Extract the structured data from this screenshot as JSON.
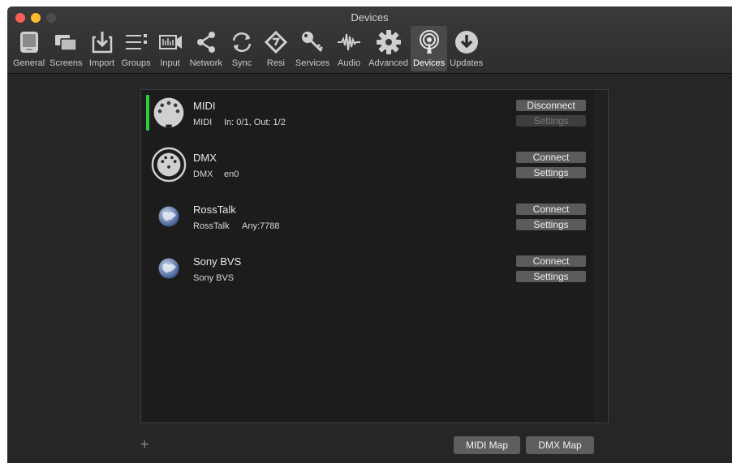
{
  "window": {
    "title": "Devices"
  },
  "toolbar": {
    "items": [
      {
        "label": "General",
        "icon": "general-icon"
      },
      {
        "label": "Screens",
        "icon": "screens-icon"
      },
      {
        "label": "Import",
        "icon": "import-icon"
      },
      {
        "label": "Groups",
        "icon": "groups-icon"
      },
      {
        "label": "Input",
        "icon": "input-icon"
      },
      {
        "label": "Network",
        "icon": "network-icon"
      },
      {
        "label": "Sync",
        "icon": "sync-icon"
      },
      {
        "label": "Resi",
        "icon": "resi-icon"
      },
      {
        "label": "Services",
        "icon": "services-key-icon"
      },
      {
        "label": "Audio",
        "icon": "audio-waveform-icon"
      },
      {
        "label": "Advanced",
        "icon": "advanced-gear-icon"
      },
      {
        "label": "Devices",
        "icon": "devices-broadcast-icon",
        "selected": true
      },
      {
        "label": "Updates",
        "icon": "updates-download-icon"
      }
    ]
  },
  "devices": [
    {
      "name": "MIDI",
      "type": "MIDI",
      "detail": "In: 0/1, Out: 1/2",
      "primary": "Disconnect",
      "secondary": "Settings",
      "secondary_disabled": true,
      "connected": true,
      "icon": "midi-connector-icon"
    },
    {
      "name": "DMX",
      "type": "DMX",
      "detail": "en0",
      "primary": "Connect",
      "secondary": "Settings",
      "secondary_disabled": false,
      "connected": false,
      "icon": "dmx-connector-icon"
    },
    {
      "name": "RossTalk",
      "type": "RossTalk",
      "detail": "Any:7788",
      "primary": "Connect",
      "secondary": "Settings",
      "secondary_disabled": false,
      "connected": false,
      "icon": "globe-icon"
    },
    {
      "name": "Sony BVS",
      "type": "Sony BVS",
      "detail": "",
      "primary": "Connect",
      "secondary": "Settings",
      "secondary_disabled": false,
      "connected": false,
      "icon": "globe-icon"
    }
  ],
  "footer": {
    "add_label": "+",
    "midi_map_label": "MIDI Map",
    "dmx_map_label": "DMX Map"
  },
  "colors": {
    "connected_accent": "#2ecc40",
    "close": "#fc5f57",
    "minimize": "#fdbc2e"
  }
}
